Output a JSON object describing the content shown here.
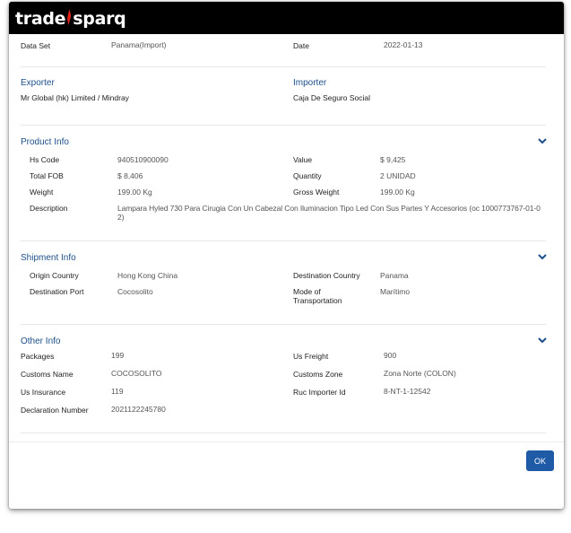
{
  "brand": {
    "part1": "trade",
    "part2": "sparq"
  },
  "dataset": {
    "label": "Data Set",
    "value": "Panama(Import)",
    "date_label": "Date",
    "date_value": "2022-01-13"
  },
  "parties": {
    "exporter_title": "Exporter",
    "exporter_value": "Mr Global (hk) Limited / Mindray",
    "importer_title": "Importer",
    "importer_value": "Caja De Seguro Social"
  },
  "product": {
    "title": "Product Info",
    "hs_code_label": "Hs Code",
    "hs_code_value": "940510900090",
    "value_label": "Value",
    "value_value": "$ 9,425",
    "fob_label": "Total FOB",
    "fob_value": "$ 8,406",
    "quantity_label": "Quantity",
    "quantity_value": "2 UNIDAD",
    "weight_label": "Weight",
    "weight_value": "199.00 Kg",
    "gross_label": "Gross Weight",
    "gross_value": "199.00 Kg",
    "desc_label": "Description",
    "desc_line1": "Lampara Hyled 730 Para Cirugia Con Un Cabezal Con Iluminacion Tipo Led Con Sus Partes Y Accesorios (oc 1000773767-01-0",
    "desc_line2": "2)"
  },
  "shipment": {
    "title": "Shipment Info",
    "origin_label": "Origin Country",
    "origin_value": "Hong Kong China",
    "dest_label": "Destination Country",
    "dest_value": "Panama",
    "port_label": "Destination Port",
    "port_value": "Cocosolito",
    "mode_label_1": "Mode of",
    "mode_label_2": "Transportation",
    "mode_value": "Marítimo"
  },
  "other": {
    "title": "Other Info",
    "packages_label": "Packages",
    "packages_value": "199",
    "freight_label": "Us Freight",
    "freight_value": "900",
    "customs_name_label": "Customs Name",
    "customs_name_value": "COCOSOLITO",
    "customs_zone_label": "Customs Zone",
    "customs_zone_value": "Zona Norte (COLON)",
    "insurance_label": "Us Insurance",
    "insurance_value": "119",
    "ruc_label": "Ruc Importer Id",
    "ruc_value": "8-NT-1-12542",
    "decl_label": "Declaration Number",
    "decl_value": "2021122245780"
  },
  "actions": {
    "ok_label": "OK"
  },
  "colors": {
    "accent": "#1f5aa6",
    "section_title": "#1d4f8a",
    "header_bg": "#000000",
    "flame": "#e2231a"
  }
}
